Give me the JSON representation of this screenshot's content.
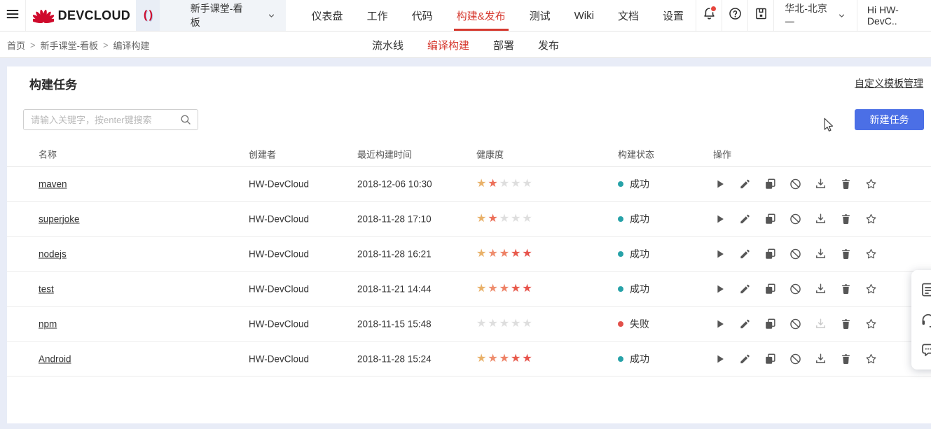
{
  "topnav": {
    "brand": "DEVCLOUD",
    "project": {
      "icon_glyph": "( )",
      "name": "新手课堂-看板"
    },
    "items": [
      {
        "label": "仪表盘",
        "active": false
      },
      {
        "label": "工作",
        "active": false
      },
      {
        "label": "代码",
        "active": false
      },
      {
        "label": "构建&发布",
        "active": true
      },
      {
        "label": "测试",
        "active": false
      },
      {
        "label": "Wiki",
        "active": false
      },
      {
        "label": "文档",
        "active": false
      },
      {
        "label": "设置",
        "active": false
      }
    ],
    "notification_dot": true,
    "region": "华北-北京一",
    "user_greeting": "Hi HW-DevC.."
  },
  "breadcrumb": {
    "separator": ">",
    "items": [
      "首页",
      "新手课堂-看板",
      "编译构建"
    ]
  },
  "subnav": {
    "items": [
      {
        "label": "流水线",
        "active": false
      },
      {
        "label": "编译构建",
        "active": true
      },
      {
        "label": "部署",
        "active": false
      },
      {
        "label": "发布",
        "active": false
      }
    ]
  },
  "page": {
    "title": "构建任务",
    "template_manage_link": "自定义模板管理",
    "search_placeholder": "请输入关键字，按enter键搜索",
    "new_task_button": "新建任务"
  },
  "table": {
    "columns": [
      "名称",
      "创建者",
      "最近构建时间",
      "健康度",
      "构建状态",
      "操作"
    ],
    "action_icons": [
      "run",
      "edit",
      "copy",
      "disable",
      "download",
      "delete",
      "favorite"
    ],
    "rows": [
      {
        "name": "maven",
        "creator": "HW-DevCloud",
        "last_build_time": "2018-12-06 10:30",
        "health_stars": 2,
        "status": "成功",
        "status_type": "success",
        "download_enabled": true
      },
      {
        "name": "superjoke",
        "creator": "HW-DevCloud",
        "last_build_time": "2018-11-28 17:10",
        "health_stars": 2,
        "status": "成功",
        "status_type": "success",
        "download_enabled": true
      },
      {
        "name": "nodejs",
        "creator": "HW-DevCloud",
        "last_build_time": "2018-11-28 16:21",
        "health_stars": 5,
        "status": "成功",
        "status_type": "success",
        "download_enabled": true
      },
      {
        "name": "test",
        "creator": "HW-DevCloud",
        "last_build_time": "2018-11-21 14:44",
        "health_stars": 5,
        "status": "成功",
        "status_type": "success",
        "download_enabled": true
      },
      {
        "name": "npm",
        "creator": "HW-DevCloud",
        "last_build_time": "2018-11-15 15:48",
        "health_stars": 0,
        "status": "失败",
        "status_type": "fail",
        "download_enabled": false
      },
      {
        "name": "Android",
        "creator": "HW-DevCloud",
        "last_build_time": "2018-11-28 15:24",
        "health_stars": 5,
        "status": "成功",
        "status_type": "success",
        "download_enabled": true
      }
    ]
  },
  "side_panel": {
    "icons": [
      "survey",
      "support",
      "feedback"
    ]
  },
  "colors": {
    "accent_red": "#d6392f",
    "brand_red": "#cf0a2c",
    "button_blue": "#4b6fe6",
    "status_success": "#27a2a8",
    "status_fail": "#e2504a",
    "star_empty": "#dedede",
    "star_gradient_2": [
      "#e9b169",
      "#ec6f59"
    ],
    "star_gradient_5": [
      "#e9b169",
      "#ee8d6e",
      "#ee8165",
      "#e85b4d",
      "#e7534c"
    ]
  }
}
